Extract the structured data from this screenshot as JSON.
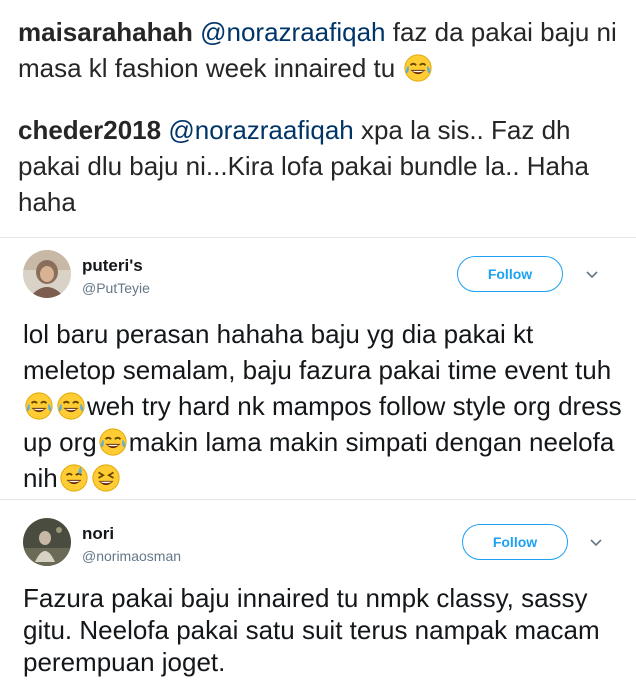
{
  "comments": [
    {
      "username": "maisarahahah",
      "mention": "@norazraafiqah",
      "text": " faz da pakai baju ni masa kl fashion week innaired tu ",
      "emoji": "tears-of-joy-emoji"
    },
    {
      "username": "cheder2018",
      "mention": "@norazraafiqah",
      "text": " xpa la sis.. Faz dh pakai dlu baju ni...Kira lofa pakai bundle la.. Haha haha"
    }
  ],
  "tweets": [
    {
      "display_name": "puteri's",
      "handle": "@PutTeyie",
      "follow_label": "Follow",
      "body": {
        "part1": "lol baru perasan hahaha baju yg dia pakai kt meletop semalam, baju fazura pakai time event tuh",
        "part2": "weh try hard nk mampos follow style org dress up org",
        "part3": "makin lama makin simpati dengan neelofa nih"
      }
    },
    {
      "display_name": "nori",
      "handle": "@norimaosman",
      "follow_label": "Follow",
      "body": "Fazura pakai baju innaired tu nmpk classy, sassy gitu. Neelofa pakai satu suit terus nampak macam perempuan joget."
    }
  ],
  "colors": {
    "accent": "#1da1f2",
    "mention": "#003569",
    "handle": "#657786",
    "divider": "#e1e8ed"
  },
  "icons": [
    "tears-of-joy-emoji",
    "sweat-smile-emoji",
    "laughing-emoji",
    "chevron-down-icon"
  ]
}
